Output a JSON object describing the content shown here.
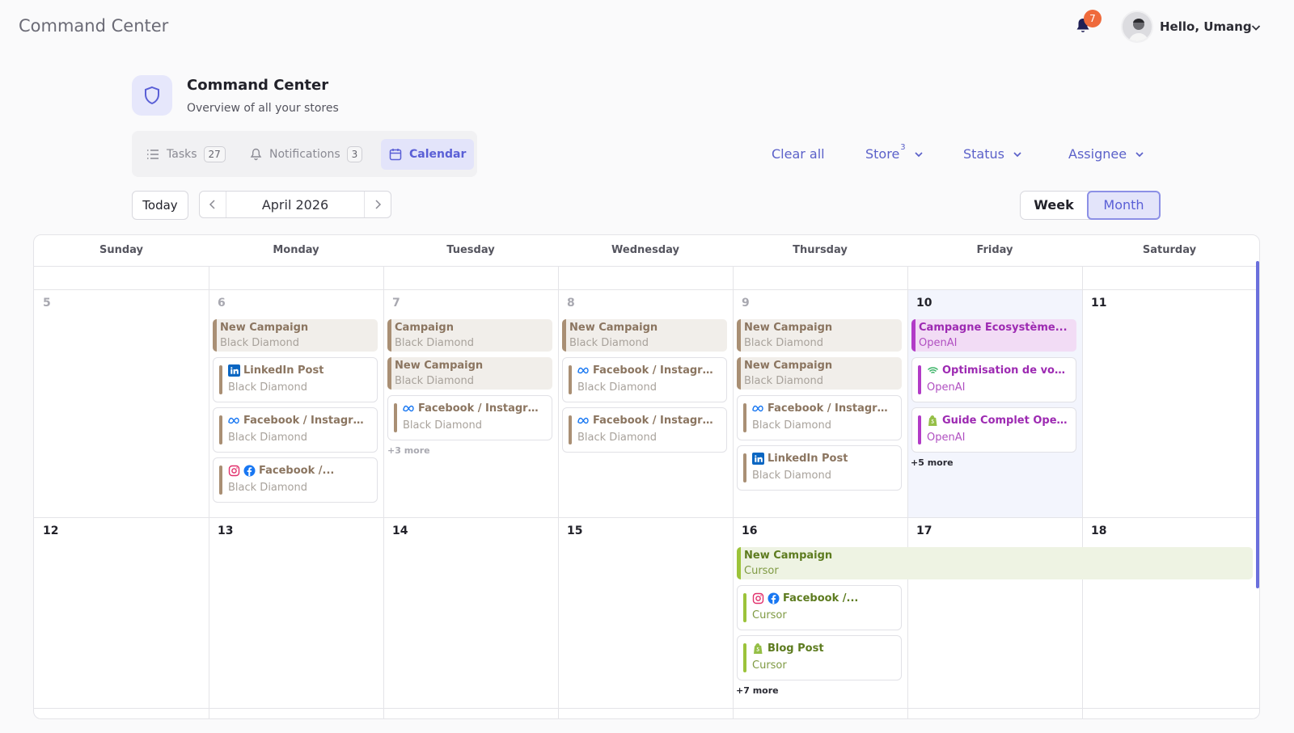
{
  "app": {
    "title": "Command Center",
    "notifications_count": "7",
    "greeting": "Hello, Umang"
  },
  "header": {
    "title": "Command Center",
    "subtitle": "Overview of all your stores"
  },
  "tabs": [
    {
      "label": "Tasks",
      "count": "27"
    },
    {
      "label": "Notifications",
      "count": "3"
    },
    {
      "label": "Calendar"
    }
  ],
  "filters": {
    "clear_all": "Clear all",
    "store": "Store",
    "store_count": "3",
    "status": "Status",
    "assignee": "Assignee"
  },
  "calendar": {
    "today_label": "Today",
    "month_label": "April 2026",
    "view_week": "Week",
    "view_month": "Month",
    "weekdays": [
      "Sunday",
      "Monday",
      "Tuesday",
      "Wednesday",
      "Thursday",
      "Friday",
      "Saturday"
    ],
    "week1_days": [
      "5",
      "6",
      "7",
      "8",
      "9",
      "10",
      "11"
    ],
    "week2_days": [
      "12",
      "13",
      "14",
      "15",
      "16",
      "17",
      "18"
    ],
    "week1_events": {
      "mon": [
        {
          "title": "New Campaign",
          "store": "Black Diamond",
          "style": "fill"
        },
        {
          "title": "LinkedIn Post",
          "store": "Black Diamond",
          "icon": "linkedin-icon"
        },
        {
          "title": "Facebook / Instagram...",
          "store": "Black Diamond",
          "icon": "meta-icon"
        },
        {
          "title": "Facebook /...",
          "store": "Black Diamond",
          "icon": "instagram-facebook-icon"
        }
      ],
      "tue": [
        {
          "title": "Campaign",
          "store": "Black Diamond",
          "style": "fill"
        },
        {
          "title": "New Campaign",
          "store": "Black Diamond",
          "style": "fill"
        },
        {
          "title": "Facebook / Instagram...",
          "store": "Black Diamond",
          "icon": "meta-icon"
        }
      ],
      "tue_more": "+3 more",
      "wed": [
        {
          "title": "New Campaign",
          "store": "Black Diamond",
          "style": "fill"
        },
        {
          "title": "Facebook / Instagram...",
          "store": "Black Diamond",
          "icon": "meta-icon"
        },
        {
          "title": "Facebook / Instagram...",
          "store": "Black Diamond",
          "icon": "meta-icon"
        }
      ],
      "thu": [
        {
          "title": "New Campaign",
          "store": "Black Diamond",
          "style": "fill"
        },
        {
          "title": "New Campaign",
          "store": "Black Diamond",
          "style": "fill"
        },
        {
          "title": "Facebook / Instagram...",
          "store": "Black Diamond",
          "icon": "meta-icon"
        },
        {
          "title": "LinkedIn Post",
          "store": "Black Diamond",
          "icon": "linkedin-icon"
        }
      ],
      "fri": [
        {
          "title": "Campagne Ecosystème...",
          "store": "OpenAI",
          "style": "fill"
        },
        {
          "title": "Optimisation de votre...",
          "store": "OpenAI",
          "icon": "wifi-icon"
        },
        {
          "title": "Guide Complet Open...",
          "store": "OpenAI",
          "icon": "shopify-icon"
        }
      ],
      "fri_more": "+5 more"
    },
    "week2_events": {
      "span": {
        "title": "New Campaign",
        "store": "Cursor"
      },
      "thu": [
        {
          "title": "Facebook /...",
          "store": "Cursor",
          "icon": "instagram-facebook-icon"
        },
        {
          "title": "Blog Post",
          "store": "Cursor",
          "icon": "shopify-icon"
        }
      ],
      "thu_more": "+7 more"
    }
  },
  "colors": {
    "accent": "#5a5fd6",
    "tan": "#a98f74",
    "purple": "#b23bc7",
    "green": "#9cc33a",
    "badge": "#ef6a3c"
  }
}
